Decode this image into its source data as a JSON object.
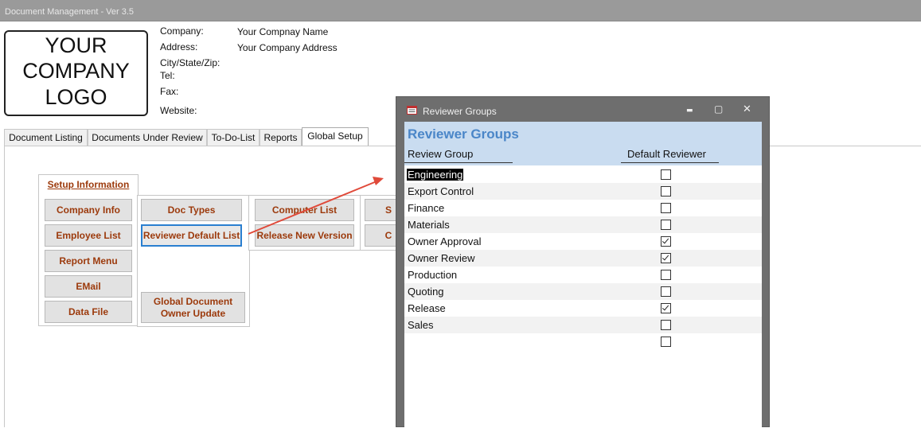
{
  "window": {
    "title": "Document Management - Ver 3.5"
  },
  "logo": {
    "line1": "YOUR",
    "line2": "COMPANY",
    "line3": "LOGO"
  },
  "company_info": {
    "company_label": "Company:",
    "company_value": "Your Compnay Name",
    "address_label": "Address:",
    "address_value": "Your Company Address",
    "city_label": "City/State/Zip:",
    "tel_label": "Tel:",
    "fax_label": "Fax:",
    "website_label": "Website:"
  },
  "tabs": [
    {
      "label": "Document Listing"
    },
    {
      "label": "Documents Under Review"
    },
    {
      "label": "To-Do-List"
    },
    {
      "label": "Reports"
    },
    {
      "label": "Global Setup",
      "active": true
    }
  ],
  "setup": {
    "section_label": "Setup Information",
    "buttons": {
      "company_info": "Company Info",
      "employee_list": "Employee List",
      "report_menu": "Report Menu",
      "email": "EMail",
      "data_file": "Data File",
      "doc_types": "Doc Types",
      "reviewer_default_list": "Reviewer Default List",
      "global_doc_owner_update_1": "Global Document",
      "global_doc_owner_update_2": "Owner Update",
      "computer_list": "Computer List",
      "release_new_version": "Release New Version",
      "partial_1": "S",
      "partial_2": "C"
    }
  },
  "dialog": {
    "window_title": "Reviewer Groups",
    "heading": "Reviewer Groups",
    "col_group": "Review Group",
    "col_default": "Default Reviewer",
    "controls": {
      "minimize": "▬",
      "maximize": "▢",
      "close": "✕"
    },
    "rows": [
      {
        "group": "Engineering",
        "default": false
      },
      {
        "group": "Export Control",
        "default": false
      },
      {
        "group": "Finance",
        "default": false
      },
      {
        "group": "Materials",
        "default": false
      },
      {
        "group": "Owner Approval",
        "default": true
      },
      {
        "group": "Owner Review",
        "default": true
      },
      {
        "group": "Production",
        "default": false
      },
      {
        "group": "Quoting",
        "default": false
      },
      {
        "group": "Release",
        "default": true
      },
      {
        "group": "Sales",
        "default": false
      },
      {
        "group": "",
        "default": false
      }
    ]
  },
  "colors": {
    "accent_text": "#9c3a0c",
    "dialog_heading": "#4a86c8",
    "arrow": "#e04a3a"
  }
}
